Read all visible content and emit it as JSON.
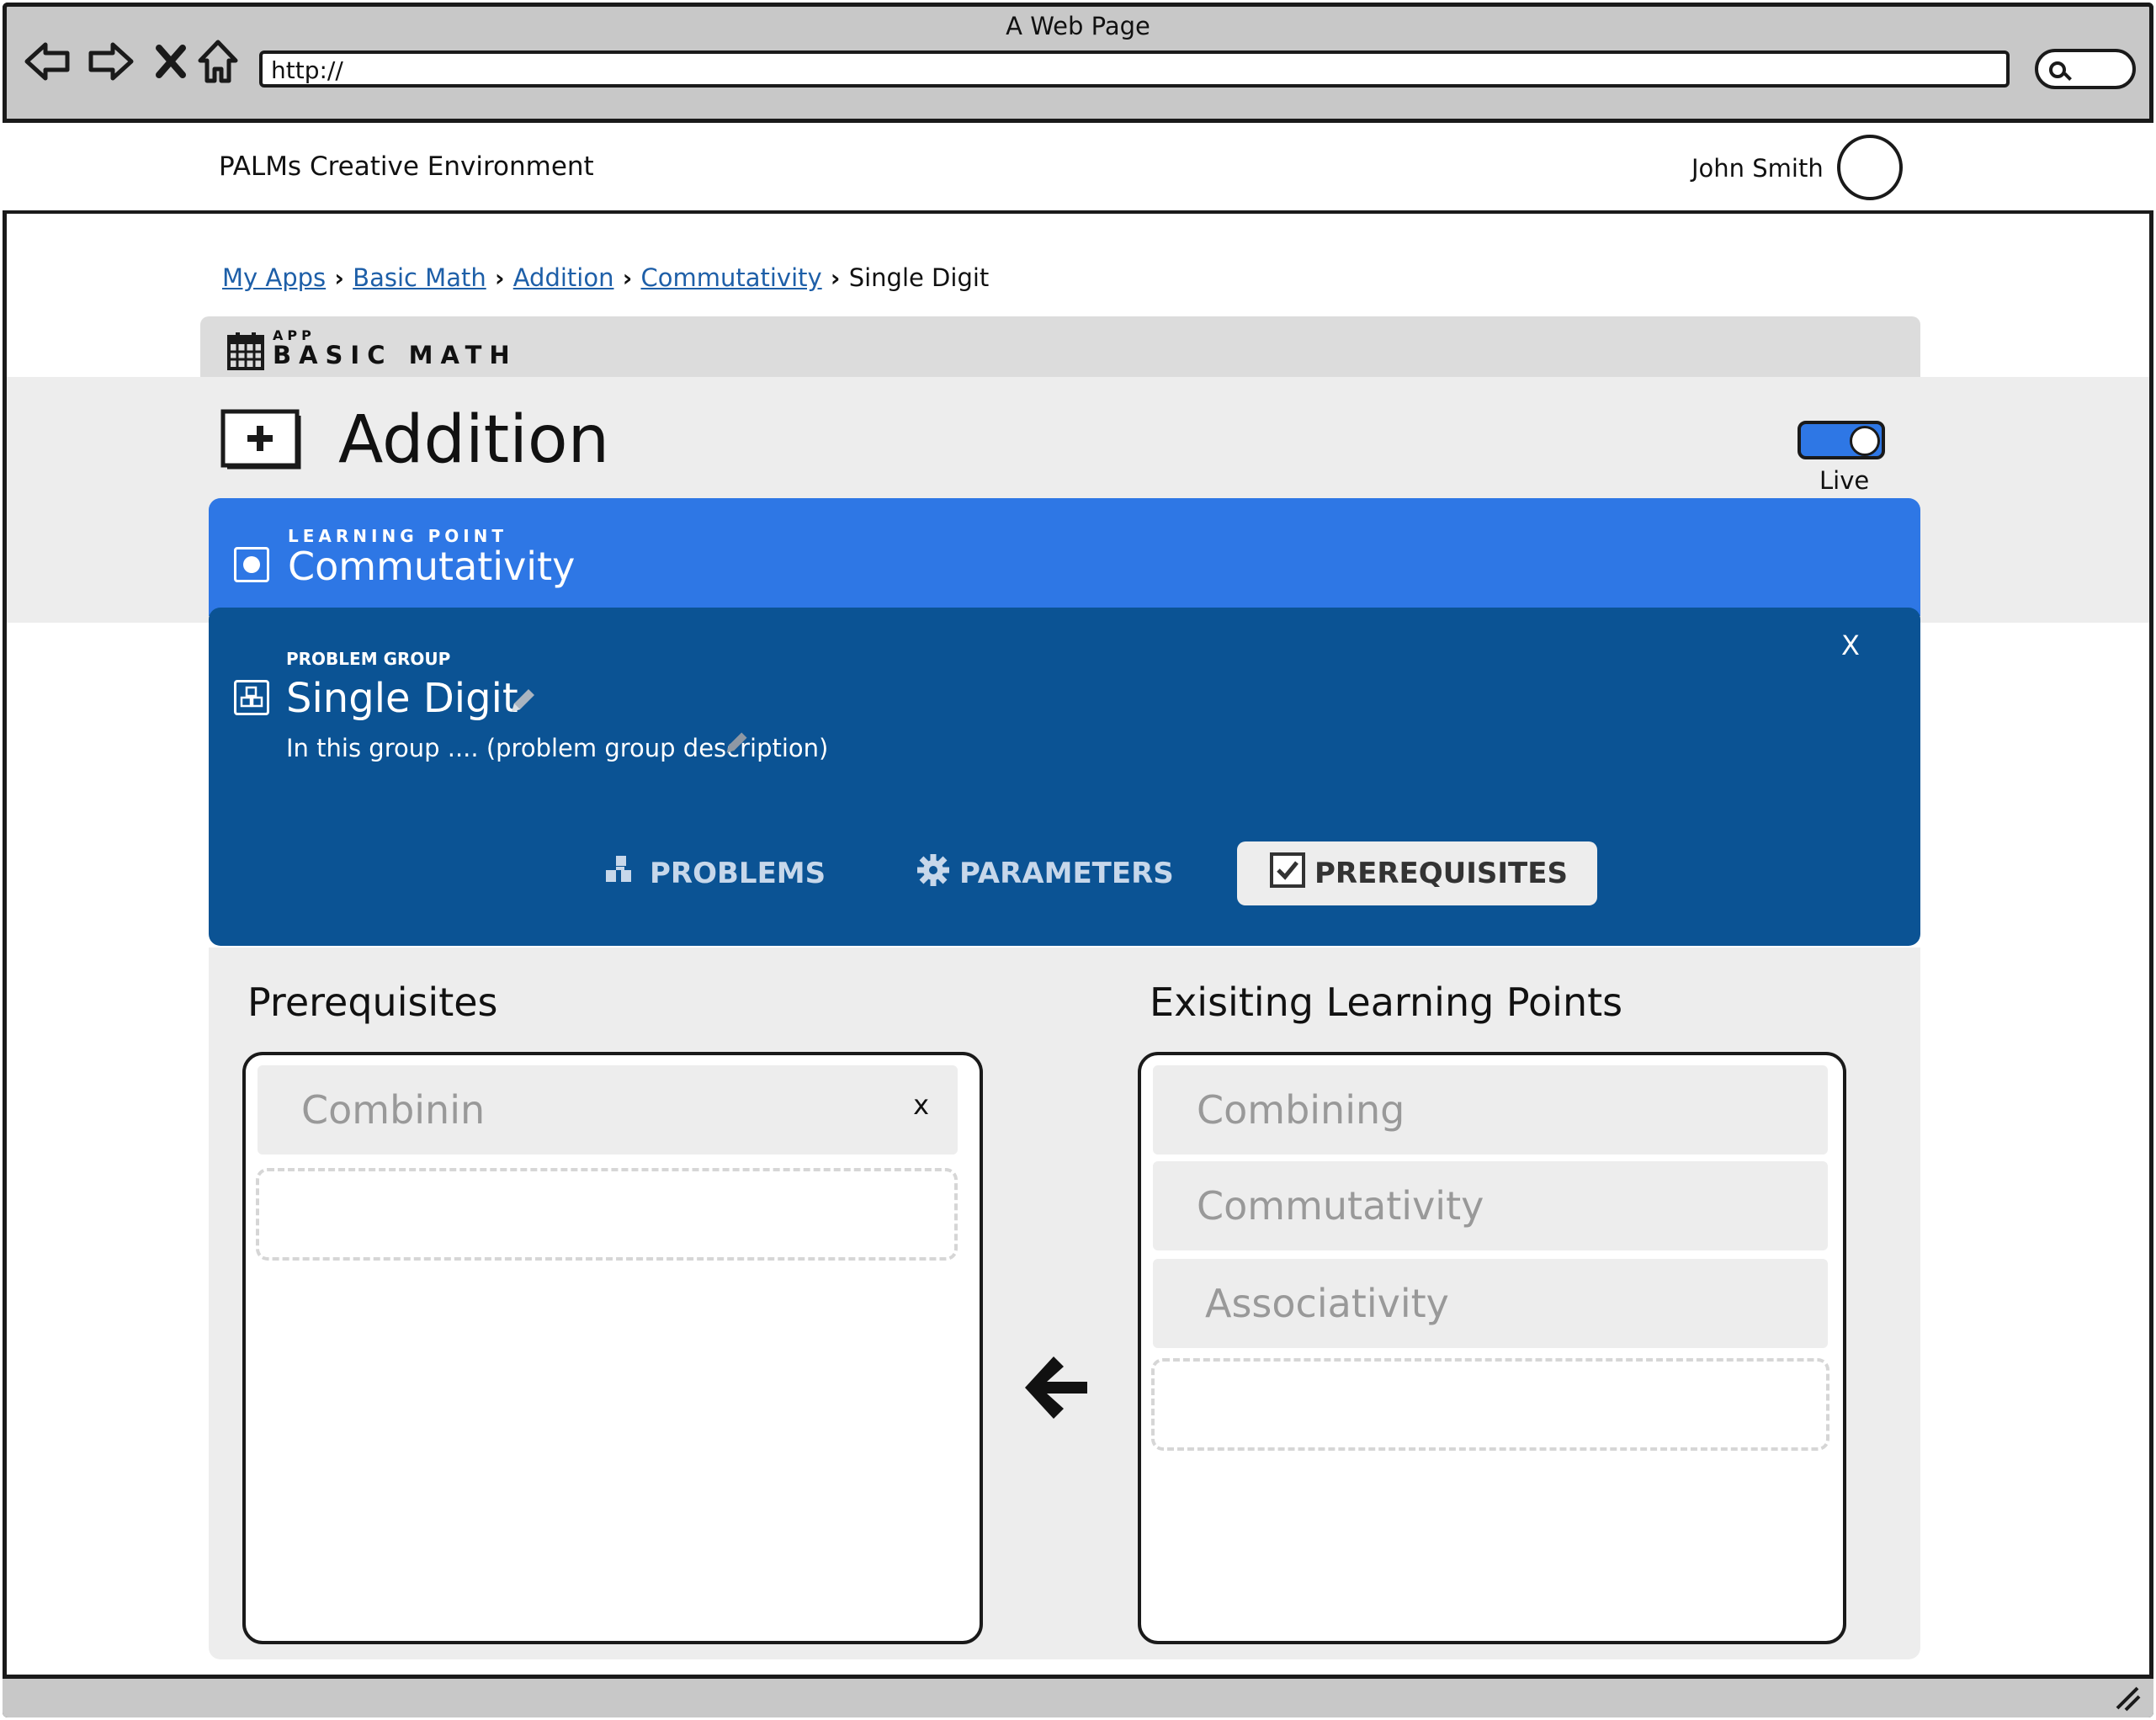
{
  "browser": {
    "window_title": "A Web Page",
    "url": "http://"
  },
  "header": {
    "brand": "PALMs Creative Environment",
    "user_name": "John Smith"
  },
  "breadcrumb": {
    "items": [
      "My Apps",
      "Basic Math",
      "Addition",
      "Commutativity"
    ],
    "current": "Single Digit"
  },
  "app": {
    "kicker": "APP",
    "name": "BASIC MATH"
  },
  "page": {
    "title": "Addition",
    "live_label": "Live",
    "live_on": true
  },
  "learning_point": {
    "kicker": "LEARNING POINT",
    "name": "Commutativity"
  },
  "problem_group": {
    "kicker": "PROBLEM GROUP",
    "name": "Single Digit",
    "description": "In this group .... (problem group description)",
    "close": "X"
  },
  "tabs": [
    {
      "label": "PROBLEMS",
      "icon": "cubes-icon",
      "active": false
    },
    {
      "label": "PARAMETERS",
      "icon": "gear-icon",
      "active": false
    },
    {
      "label": "PREREQUISITES",
      "icon": "checkbox-icon",
      "active": true
    }
  ],
  "prerequisites": {
    "title": "Prerequisites",
    "items": [
      {
        "label": "Combinin",
        "remove": "x"
      }
    ]
  },
  "existing": {
    "title": "Exisiting Learning Points",
    "items": [
      "Combining",
      "Commutativity",
      "Associativity"
    ]
  },
  "colors": {
    "learning_point_bg": "#2e77e5",
    "problem_group_bg": "#0b5394",
    "link": "#1e5fa8",
    "panel_bg": "#ededed"
  }
}
